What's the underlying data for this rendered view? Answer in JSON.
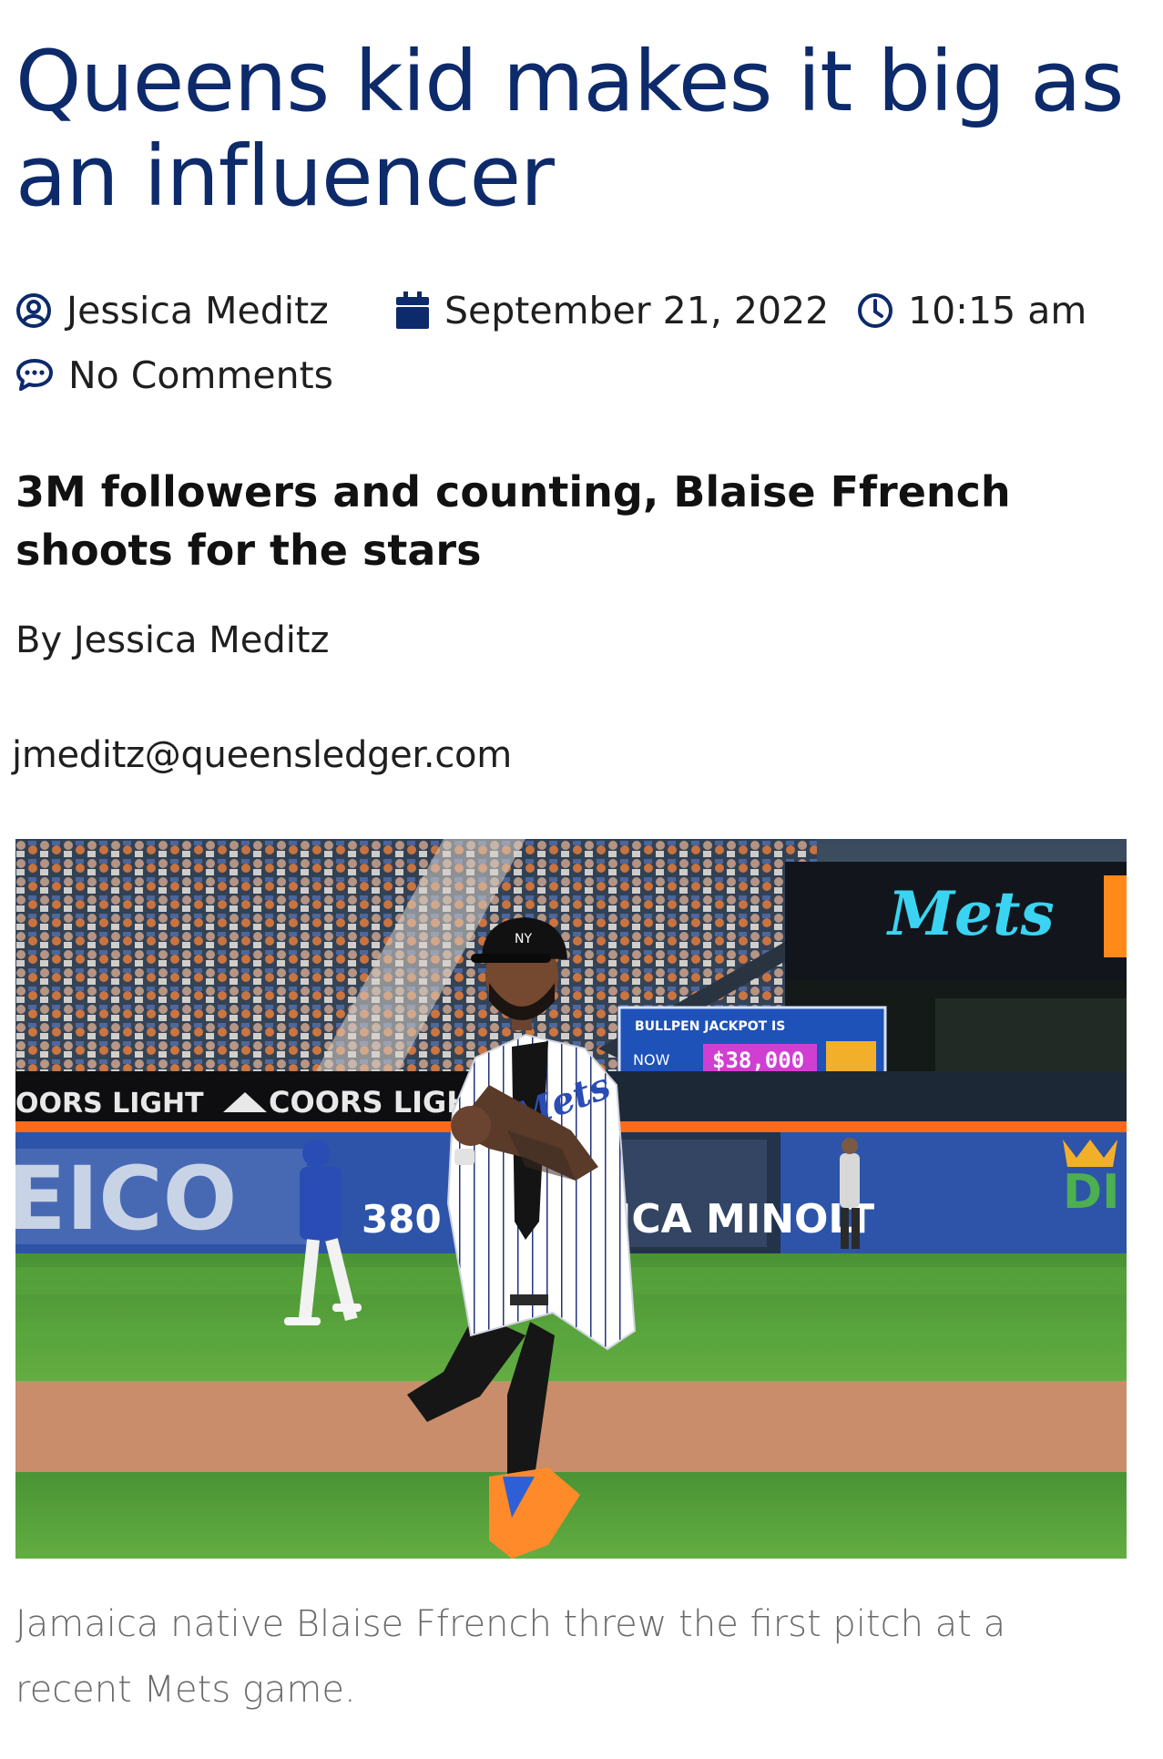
{
  "article": {
    "title": "Queens kid makes it big as an influencer",
    "author": "Jessica Meditz",
    "date": "September 21, 2022",
    "time": "10:15 am",
    "comments": "No Comments",
    "subheading": "3M followers and counting, Blaise Ffrench shoots for the stars",
    "byline": "By Jessica Meditz",
    "email": "jmeditz@queensledger.com",
    "caption": "Jamaica native Blaise Ffrench threw the first pitch at a recent Mets game."
  },
  "photo": {
    "signs": {
      "coors_left": "OORS LIGHT",
      "coors_right": "COORS LIGHT",
      "geico": "EICO",
      "distance": "380",
      "minolta": "ICA MINOLT",
      "mets_logo": "Mets",
      "jackpot_line1": "BULLPEN JACKPOT IS",
      "jackpot_line2": "NOW",
      "jackpot_amount": "$38,000",
      "right_ad": "DI"
    }
  },
  "colors": {
    "title": "#0d2a6b",
    "icon": "#0d2a6b",
    "caption": "#6b6b6b",
    "grass": "#4f9a37",
    "dirt": "#c98d6b",
    "wall": "#2d54a8",
    "mets_orange": "#ff6a1a"
  },
  "icons": [
    "user-circle-icon",
    "calendar-icon",
    "clock-icon",
    "comment-icon"
  ]
}
